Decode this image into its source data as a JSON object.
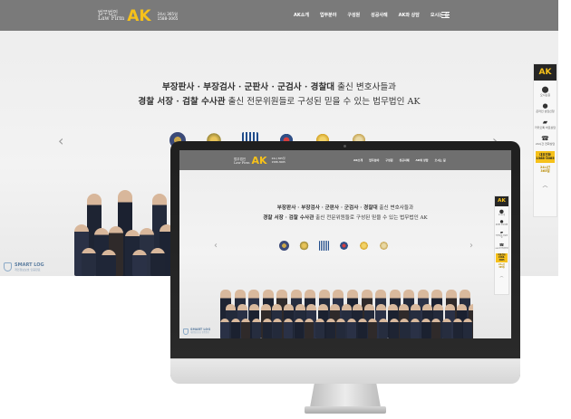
{
  "site": {
    "logo_line1": "법무법인",
    "logo_line2": "Law Firm",
    "logo_mark": "AK",
    "logo_sub1": "24시 365일",
    "logo_sub2": "1588-3065",
    "nav": [
      "AK소개",
      "업무분야",
      "구성원",
      "성공사례",
      "AK와 상담",
      "오시는 길"
    ],
    "menu_icon": "hamburger-icon",
    "headline_1_bold": "부장판사 · 부장검사 · 군판사 · 군검사 · 경찰대",
    "headline_1_rest": " 출신 변호사들과",
    "headline_2_bold": "경찰 서장 · 검찰 수사관",
    "headline_2_rest": " 출신 전문위원들로 구성된 믿을 수 있는 법무법인 AK",
    "arrow_left": "‹",
    "arrow_right": "›",
    "emblems": [
      "court-emblem-icon",
      "military-emblem-icon",
      "prosecution-emblem-icon",
      "police-emblem-icon",
      "police-university-emblem-icon",
      "investigation-emblem-icon"
    ],
    "smartlog": {
      "title": "SMART LOG",
      "subtitle": "개인정보보호 인증완료"
    },
    "quickbar": {
      "brand": "AK",
      "items": [
        {
          "icon": "map-pin-icon",
          "label": "오시는길"
        },
        {
          "icon": "chat-icon",
          "label": "온라인 상담신청"
        },
        {
          "icon": "kakaotalk-icon",
          "label": "카카오톡 바로상담"
        },
        {
          "icon": "phone-24h-icon",
          "label": "24시간 전화상담"
        }
      ],
      "box_line1": "대표전화",
      "box_line2": "1588-3065",
      "sub_line1": "24시간",
      "sub_line2": "365일",
      "up": "︿"
    }
  },
  "colors": {
    "header_bg": "#7a7a7a",
    "brand_yellow": "#f6c11a",
    "dark": "#262626"
  }
}
